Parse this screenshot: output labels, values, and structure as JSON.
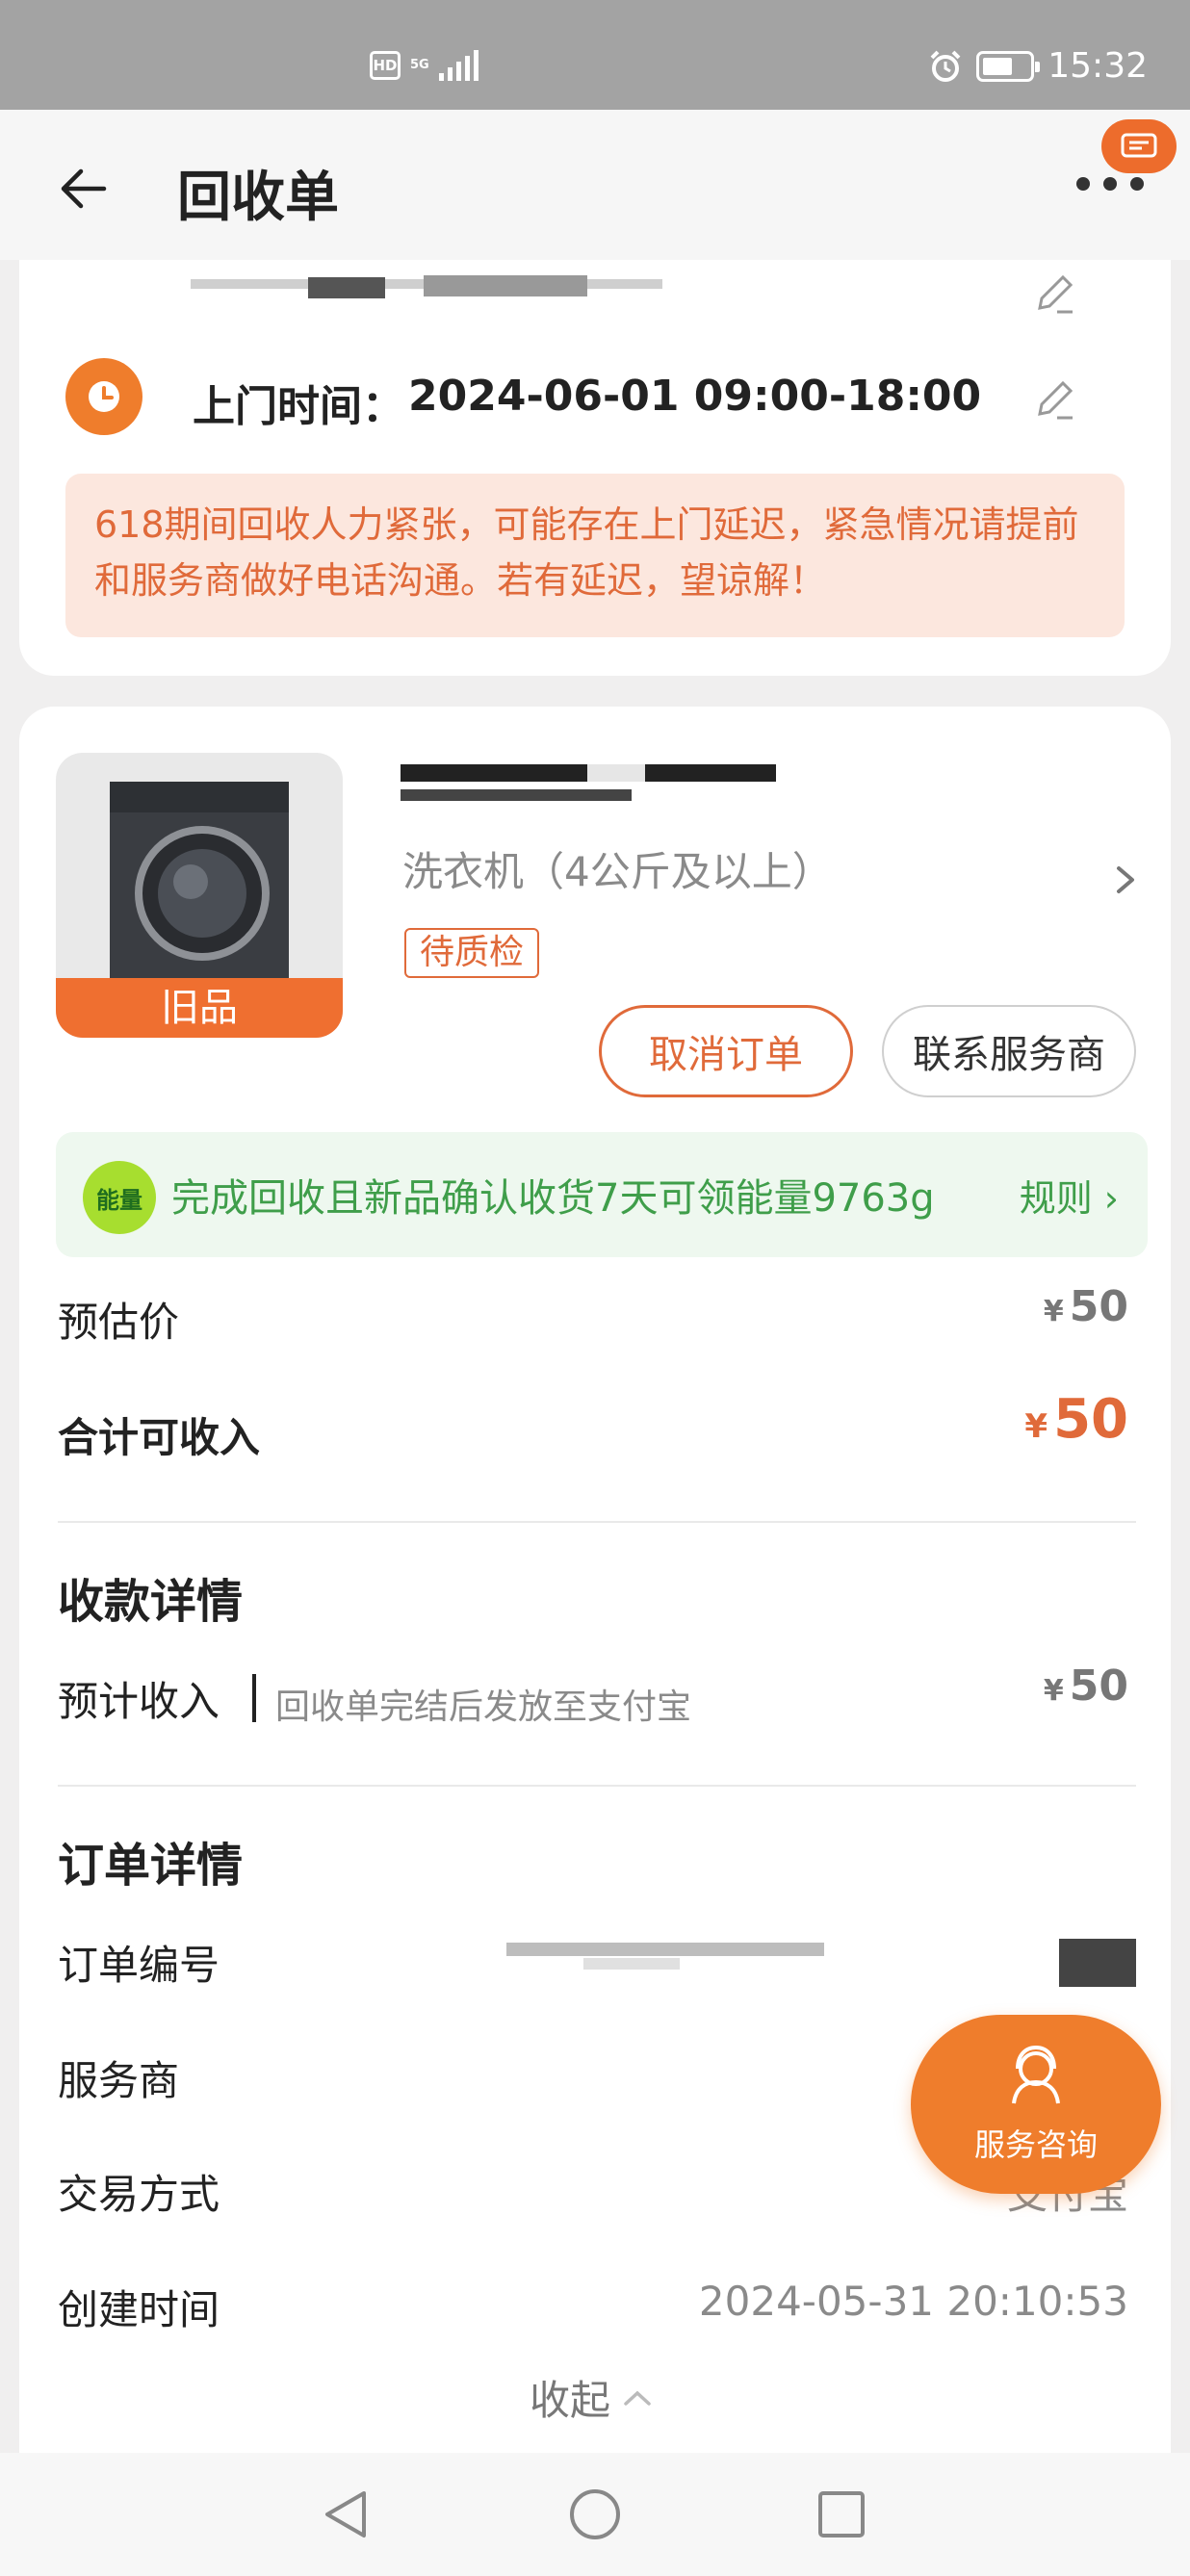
{
  "status_bar": {
    "hd": "HD",
    "network": "5G",
    "time": "15:32"
  },
  "app_bar": {
    "title": "回收单",
    "back_icon": "arrow-left-icon",
    "more_icon": "more-dots-icon"
  },
  "address": {
    "edit_icon": "pencil-icon"
  },
  "visit": {
    "label": "上门时间：",
    "value": "2024-06-01 09:00-18:00"
  },
  "notice": "618期间回收人力紧张，可能存在上门延迟，紧急情况请提前和服务商做好电话沟通。若有延迟，望谅解！",
  "product": {
    "image_label": "旧品",
    "category": "洗衣机（4公斤及以上）",
    "status": "待质检",
    "cancel_button": "取消订单",
    "contact_button": "联系服务商"
  },
  "energy": {
    "badge": "能量",
    "text": "完成回收且新品确认收货7天可领能量9763g",
    "rule": "规则 ›"
  },
  "pricing": {
    "estimate_label": "预估价",
    "currency": "¥",
    "estimate_value": "50",
    "total_label": "合计可收入",
    "total_value": "50"
  },
  "payment": {
    "title": "收款详情",
    "expected_label": "预计收入",
    "expected_note": "回收单完结后发放至支付宝",
    "expected_value": "50"
  },
  "order": {
    "title": "订单详情",
    "number_label": "订单编号",
    "provider_label": "服务商",
    "trade_label": "交易方式",
    "trade_value": "支付宝",
    "created_label": "创建时间",
    "created_value": "2024-05-31 20:10:53",
    "collapse": "收起"
  },
  "fab": {
    "label": "服务咨询",
    "icon": "customer-service-icon"
  },
  "nav": {
    "back": "nav-back-icon",
    "home": "nav-home-icon",
    "recents": "nav-recents-icon"
  },
  "colors": {
    "accent": "#ef7d2c",
    "accent_text": "#e06a3a",
    "energy_green": "#3f9e4a",
    "status_bar": "#a3a3a3"
  }
}
